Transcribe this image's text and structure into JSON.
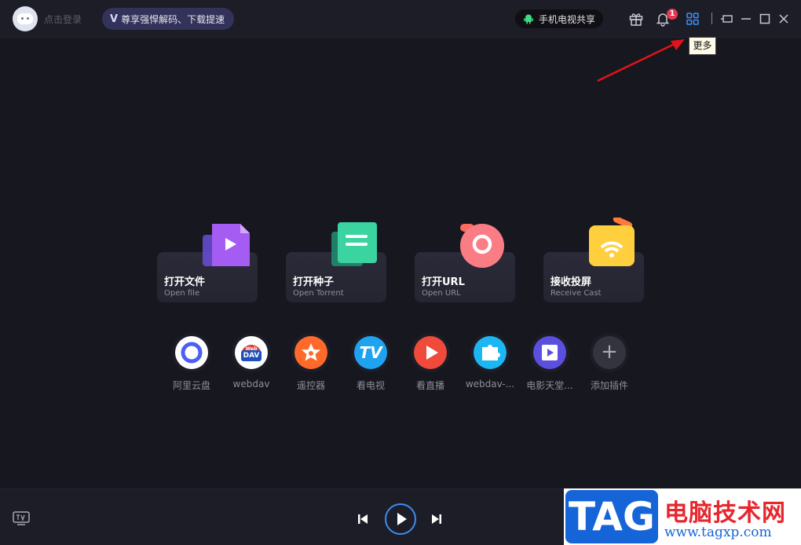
{
  "titlebar": {
    "login_text": "点击登录",
    "vip_mark": "V",
    "vip_text": "尊享强悍解码、下载提速",
    "share_text": "手机电视共享",
    "notification_count": "1",
    "tooltip_text": "更多"
  },
  "cards": [
    {
      "title": "打开文件",
      "sub": "Open file"
    },
    {
      "title": "打开种子",
      "sub": "Open Torrent"
    },
    {
      "title": "打开URL",
      "sub": "Open URL"
    },
    {
      "title": "接收投屏",
      "sub": "Receive Cast"
    }
  ],
  "plugins": [
    {
      "label": "阿里云盘"
    },
    {
      "label": "webdav",
      "badge_top": "Web",
      "badge_bottom": "DAV"
    },
    {
      "label": "遥控器"
    },
    {
      "label": "看电视",
      "glyph": "TV"
    },
    {
      "label": "看直播"
    },
    {
      "label": "webdav-..."
    },
    {
      "label": "电影天堂..."
    },
    {
      "label": "添加插件",
      "glyph": "+"
    }
  ],
  "watermark": {
    "tag": "TAG",
    "cn": "电脑技术网",
    "url": "www.tagxp.com"
  },
  "colors": {
    "background": "#17171f",
    "accent_blue": "#3a8df3",
    "badge_red": "#e8374d",
    "arrow_red": "#e0141a"
  }
}
